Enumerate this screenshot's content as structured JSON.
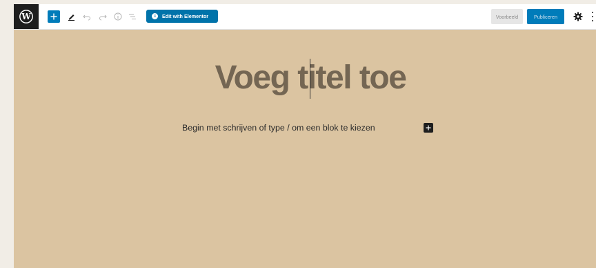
{
  "toolbar": {
    "logo": "wordpress-logo",
    "add_icon": "plus-icon",
    "tools_icon": "pencil-icon",
    "undo_icon": "undo-icon",
    "redo_icon": "redo-icon",
    "info_icon": "info-icon",
    "outline_icon": "list-view-icon",
    "elementor_label": "Edit with Elementor",
    "elementor_icon": "elementor-e-icon",
    "preview_label": "Voorbeeld",
    "publish_label": "Publiceren",
    "settings_icon": "gear-icon",
    "more_icon": "kebab-menu-icon"
  },
  "editor": {
    "title_placeholder": "Voeg titel toe",
    "paragraph_placeholder": "Begin met schrijven of type / om een blok te kiezen",
    "inline_add_icon": "plus-icon"
  },
  "colors": {
    "canvas_bg": "#dbc4a1",
    "accent": "#007cba",
    "elementor": "#0073aa",
    "title_text": "#746653"
  }
}
